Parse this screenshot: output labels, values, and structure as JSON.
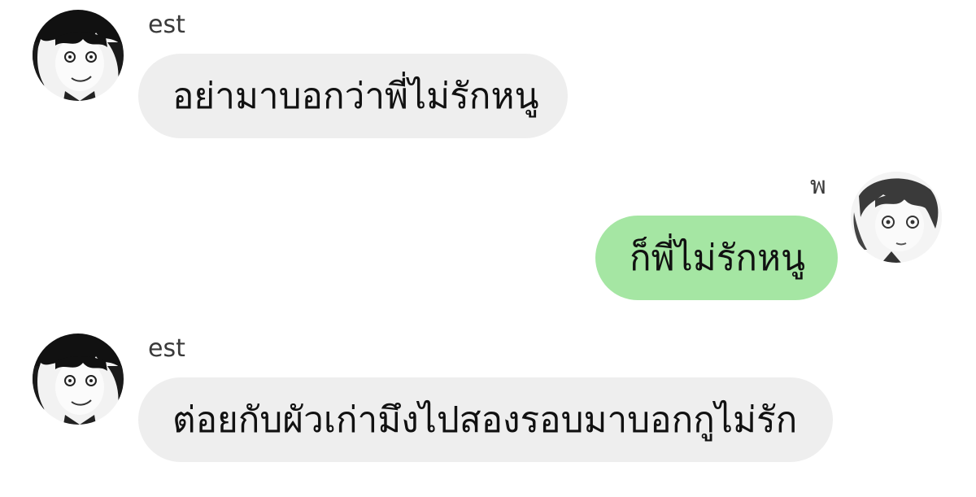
{
  "messages": [
    {
      "sender": "est",
      "direction": "incoming",
      "avatar_icon": "manga-avatar-dark-hair-icon",
      "text": "อย่ามาบอกว่าพี่ไม่รักหนู"
    },
    {
      "sender": "พ",
      "direction": "outgoing",
      "avatar_icon": "manga-avatar-boy-icon",
      "text": "ก็พี่ไม่รักหนู"
    },
    {
      "sender": "est",
      "direction": "incoming",
      "avatar_icon": "manga-avatar-dark-hair-icon",
      "text": "ต่อยกับผัวเก่ามึงไปสองรอบมาบอกกูไม่รัก"
    }
  ],
  "colors": {
    "incoming_bubble": "#eeeeee",
    "outgoing_bubble": "#a5e6a3",
    "background": "#ffffff"
  }
}
